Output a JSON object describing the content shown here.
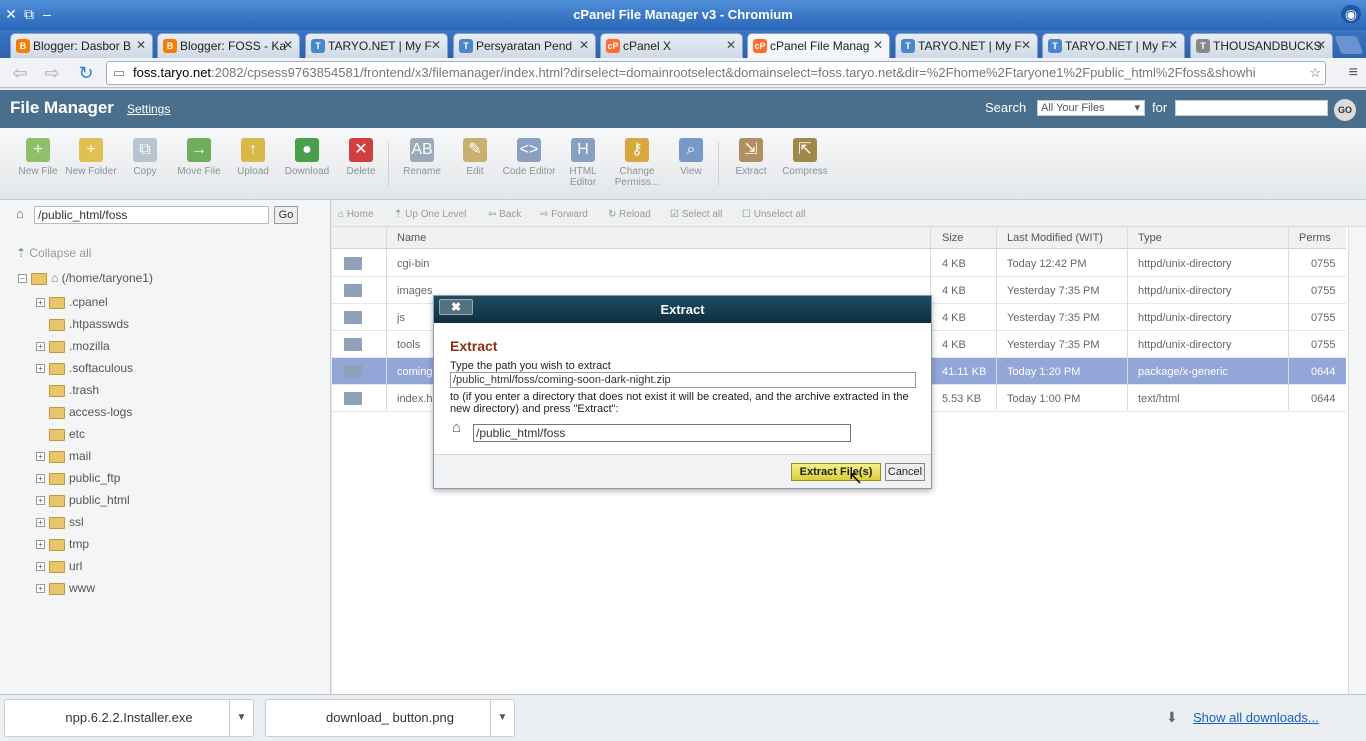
{
  "window": {
    "title": "cPanel File Manager v3 - Chromium"
  },
  "tabs": [
    {
      "label": "Blogger: Dasbor B",
      "fav": "B",
      "color": "#f57d00"
    },
    {
      "label": "Blogger: FOSS - Ka",
      "fav": "B",
      "color": "#f57d00"
    },
    {
      "label": "TARYO.NET | My F",
      "fav": "T",
      "color": "#4a86c8"
    },
    {
      "label": "Persyaratan Pend",
      "fav": "T",
      "color": "#4a86c8"
    },
    {
      "label": "cPanel X",
      "fav": "cP",
      "color": "#ff6c2c"
    },
    {
      "label": "cPanel File Manag",
      "fav": "cP",
      "color": "#ff6c2c"
    },
    {
      "label": "TARYO.NET | My F",
      "fav": "T",
      "color": "#4a86c8"
    },
    {
      "label": "TARYO.NET | My F",
      "fav": "T",
      "color": "#4a86c8"
    },
    {
      "label": "THOUSANDBUCKS",
      "fav": "T",
      "color": "#888888"
    }
  ],
  "url": {
    "host": "foss.taryo.net",
    "rest": ":2082/cpsess9763854581/frontend/x3/filemanager/index.html?dirselect=domainrootselect&domainselect=foss.taryo.net&dir=%2Fhome%2Ftaryone1%2Fpublic_html%2Ffoss&showhi"
  },
  "header": {
    "title": "File Manager",
    "settings": "Settings",
    "search_label": "Search",
    "search_scope": "All Your Files",
    "for_label": "for",
    "go": "GO"
  },
  "ribbon": [
    {
      "label": "New File",
      "icon": "new-file-icon"
    },
    {
      "label": "New Folder",
      "icon": "new-folder-icon"
    },
    {
      "label": "Copy",
      "icon": "copy-icon"
    },
    {
      "label": "Move File",
      "icon": "move-file-icon"
    },
    {
      "label": "Upload",
      "icon": "upload-icon"
    },
    {
      "label": "Download",
      "icon": "download-icon"
    },
    {
      "label": "Delete",
      "icon": "delete-icon"
    },
    {
      "label": "Rename",
      "icon": "rename-icon"
    },
    {
      "label": "Edit",
      "icon": "edit-icon"
    },
    {
      "label": "Code Editor",
      "icon": "code-editor-icon"
    },
    {
      "label": "HTML Editor",
      "icon": "html-editor-icon"
    },
    {
      "label": "Change Permiss...",
      "icon": "permissions-icon"
    },
    {
      "label": "View",
      "icon": "view-icon"
    },
    {
      "label": "Extract",
      "icon": "extract-icon"
    },
    {
      "label": "Compress",
      "icon": "compress-icon"
    }
  ],
  "left": {
    "path": "/public_html/foss",
    "go": "Go",
    "collapse": "Collapse all",
    "root": "(/home/taryone1)",
    "tree": [
      {
        "name": ".cpanel",
        "pm": true
      },
      {
        "name": ".htpasswds",
        "pm": false
      },
      {
        "name": ".mozilla",
        "pm": true
      },
      {
        "name": ".softaculous",
        "pm": true
      },
      {
        "name": ".trash",
        "pm": false
      },
      {
        "name": "access-logs",
        "pm": false
      },
      {
        "name": "etc",
        "pm": false
      },
      {
        "name": "mail",
        "pm": true
      },
      {
        "name": "public_ftp",
        "pm": true
      },
      {
        "name": "public_html",
        "pm": true
      },
      {
        "name": "ssl",
        "pm": true
      },
      {
        "name": "tmp",
        "pm": true
      },
      {
        "name": "url",
        "pm": true
      },
      {
        "name": "www",
        "pm": true
      }
    ]
  },
  "navbar": [
    "Home",
    "Up One Level",
    "Back",
    "Forward",
    "Reload",
    "Select all",
    "Unselect all"
  ],
  "columns": [
    "Name",
    "Size",
    "Last Modified (WIT)",
    "Type",
    "Perms"
  ],
  "files": [
    {
      "name": "cgi-bin",
      "size": "4 KB",
      "modified": "Today 12:42 PM",
      "type": "httpd/unix-directory",
      "perms": "0755"
    },
    {
      "name": "images",
      "size": "4 KB",
      "modified": "Yesterday 7:35 PM",
      "type": "httpd/unix-directory",
      "perms": "0755"
    },
    {
      "name": "js",
      "size": "4 KB",
      "modified": "Yesterday 7:35 PM",
      "type": "httpd/unix-directory",
      "perms": "0755"
    },
    {
      "name": "tools",
      "size": "4 KB",
      "modified": "Yesterday 7:35 PM",
      "type": "httpd/unix-directory",
      "perms": "0755"
    },
    {
      "name": "comingi",
      "size": "41.11 KB",
      "modified": "Today 1:20 PM",
      "type": "package/x-generic",
      "perms": "0644"
    },
    {
      "name": "index.h",
      "size": "5.53 KB",
      "modified": "Today 1:00 PM",
      "type": "text/html",
      "perms": "0644"
    }
  ],
  "dialog": {
    "header": "Extract",
    "close": "✖",
    "title": "Extract",
    "line1": "Type the path you wish to extract",
    "source": "/public_html/foss/coming-soon-dark-night.zip",
    "line2": "to (if you enter a directory that does not exist it will be created, and the archive extracted in the new directory) and press \"Extract\":",
    "target": "/public_html/foss",
    "extract_btn": "Extract File(s)",
    "cancel_btn": "Cancel"
  },
  "downloads": {
    "items": [
      "npp.6.2.2.Installer.exe",
      "download_ button.png"
    ],
    "show_all": "Show all downloads..."
  }
}
